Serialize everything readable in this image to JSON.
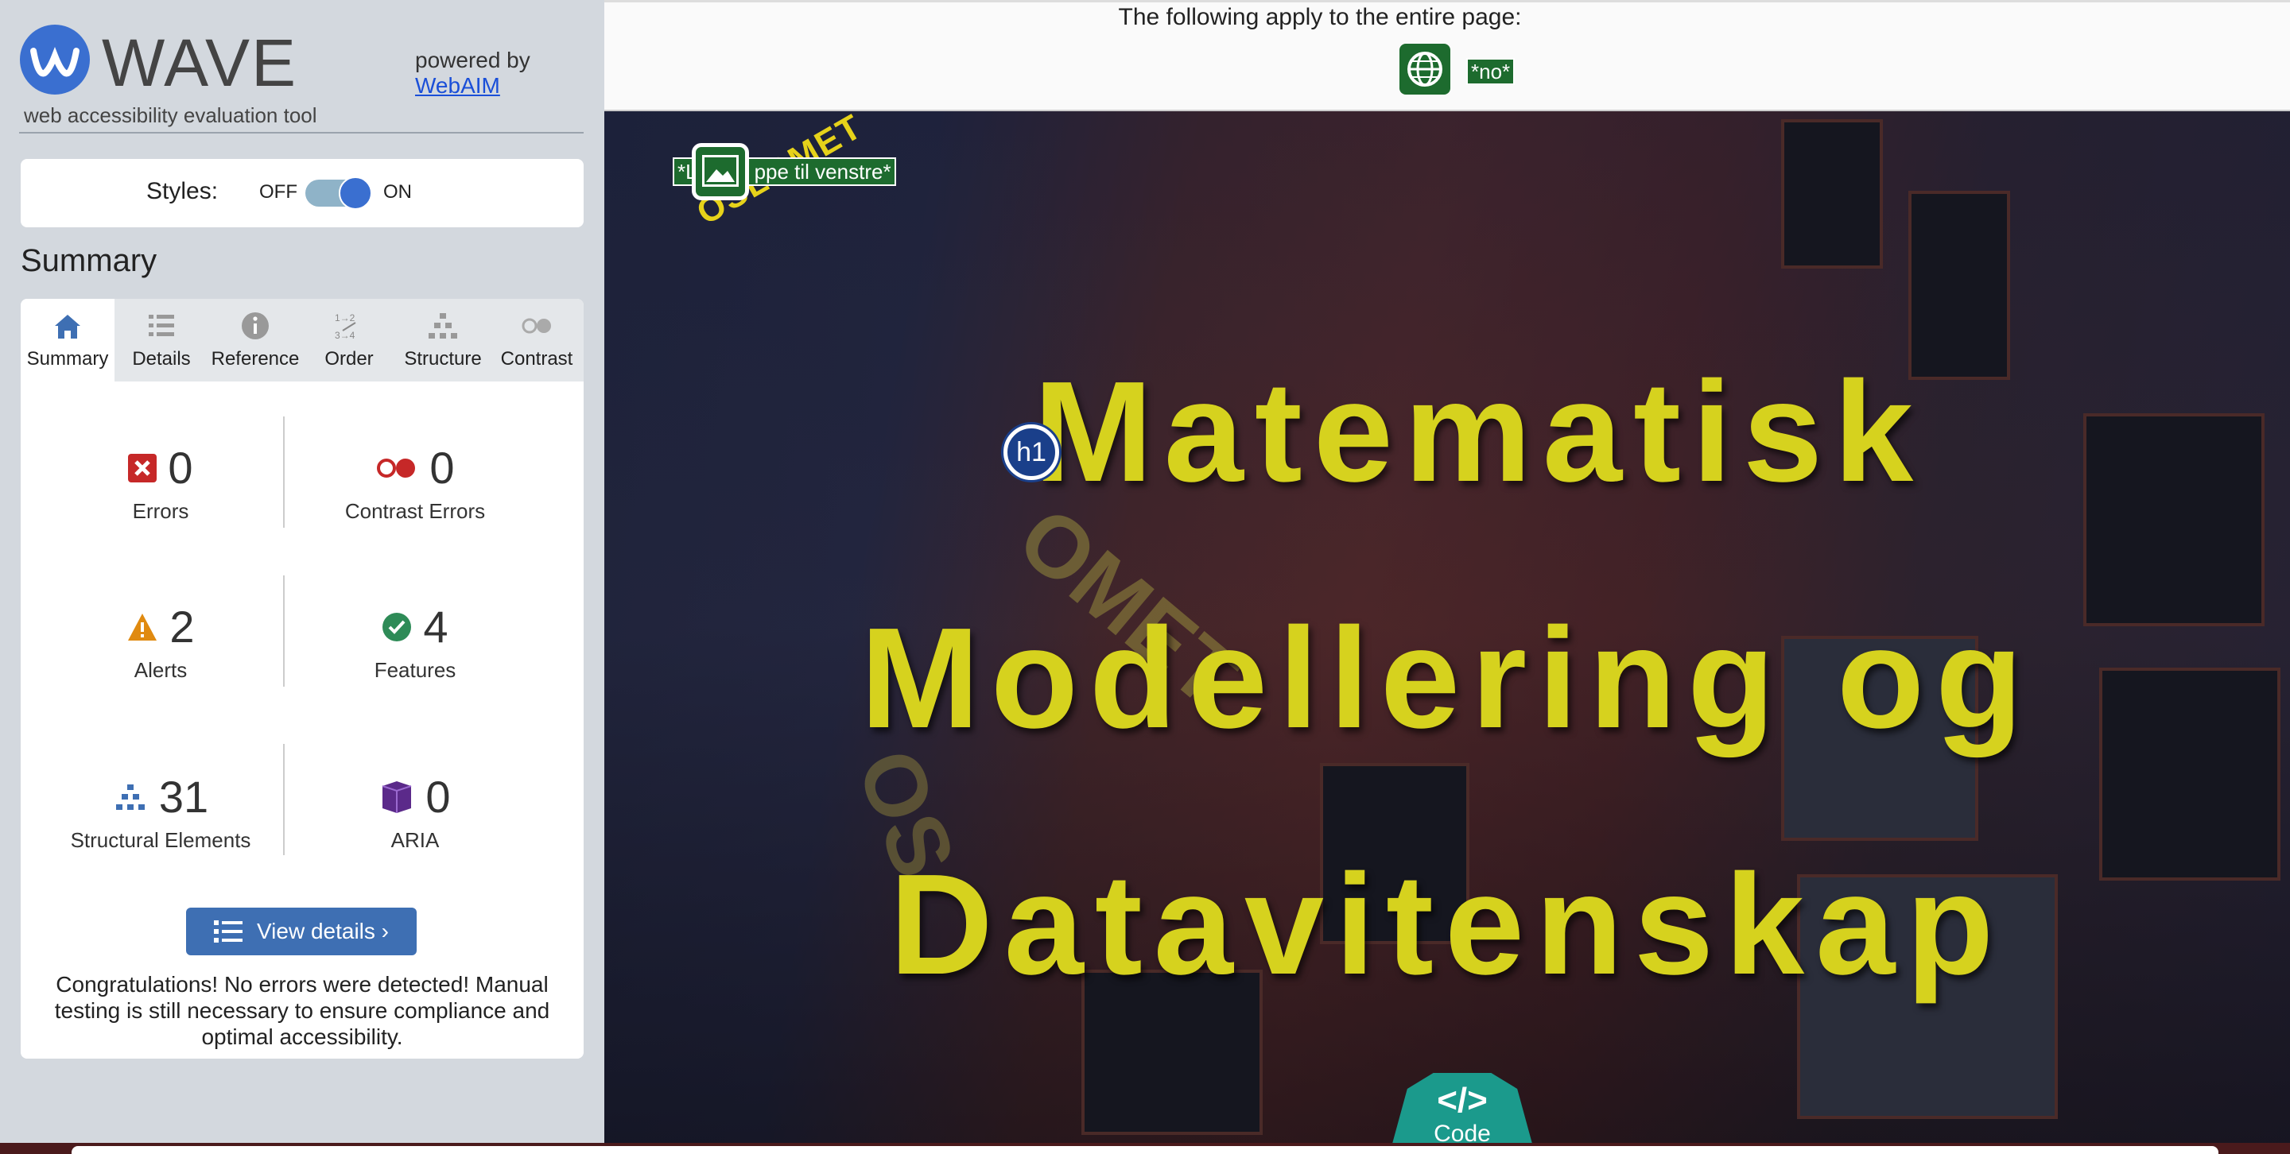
{
  "sidebar": {
    "logo": {
      "name": "WAVE",
      "subtitle": "web accessibility evaluation tool"
    },
    "powered_by": {
      "text": "powered by",
      "link": "WebAIM"
    },
    "styles": {
      "label": "Styles:",
      "off": "OFF",
      "on": "ON",
      "state": "ON"
    },
    "summary_title": "Summary",
    "tabs": [
      {
        "label": "Summary",
        "icon": "home-icon",
        "active": true
      },
      {
        "label": "Details",
        "icon": "list-icon",
        "active": false
      },
      {
        "label": "Reference",
        "icon": "info-icon",
        "active": false
      },
      {
        "label": "Order",
        "icon": "order-icon",
        "active": false
      },
      {
        "label": "Structure",
        "icon": "structure-icon",
        "active": false
      },
      {
        "label": "Contrast",
        "icon": "contrast-icon",
        "active": false
      }
    ],
    "stats": {
      "errors": {
        "count": "0",
        "label": "Errors"
      },
      "contrast_errors": {
        "count": "0",
        "label": "Contrast Errors"
      },
      "alerts": {
        "count": "2",
        "label": "Alerts"
      },
      "features": {
        "count": "4",
        "label": "Features"
      },
      "structural": {
        "count": "31",
        "label": "Structural Elements"
      },
      "aria": {
        "count": "0",
        "label": "ARIA"
      }
    },
    "view_details": "View details ›",
    "congrats": "Congratulations! No errors were detected! Manual testing is still necessary to ensure compliance and optimal accessibility."
  },
  "topbar": {
    "text": "The following apply to the entire page:",
    "lang_badge": "*no*"
  },
  "hero": {
    "alt_text": "*Logo oppe til venstre*",
    "alt_visible_start": "*L",
    "alt_visible_end": "ppe til venstre*",
    "logo_text": "OSLOMET",
    "h1_badge": "h1",
    "title_lines": [
      "Matematisk",
      "Modellering og",
      "Datavitenskap"
    ]
  },
  "code_button": {
    "glyph": "</>",
    "label": "Code"
  },
  "colors": {
    "sidebar_bg": "#d3d8de",
    "accent_blue": "#3e6fb3",
    "feature_green": "#1d6b2e",
    "title_yellow": "#d6d21e",
    "code_teal": "#1b9a8c"
  }
}
